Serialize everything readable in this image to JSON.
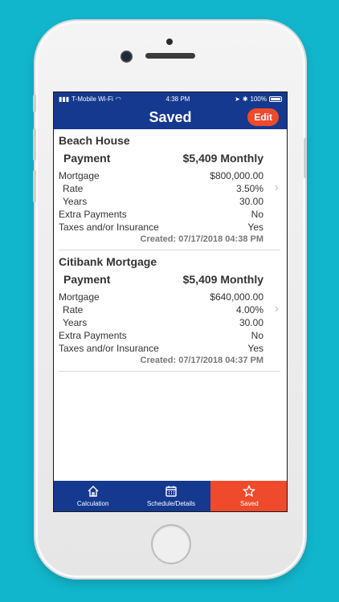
{
  "status_bar": {
    "carrier": "T-Mobile Wi-Fi",
    "time": "4:38 PM",
    "battery": "100%"
  },
  "nav": {
    "title": "Saved",
    "edit_label": "Edit"
  },
  "items": [
    {
      "title": "Beach House",
      "payment_label": "Payment",
      "payment_value": "$5,409 Monthly",
      "mortgage_label": "Mortgage",
      "mortgage_value": "$800,000.00",
      "rate_label": "Rate",
      "rate_value": "3.50%",
      "years_label": "Years",
      "years_value": "30.00",
      "extra_label": "Extra Payments",
      "extra_value": "No",
      "taxes_label": "Taxes and/or Insurance",
      "taxes_value": "Yes",
      "created": "Created: 07/17/2018 04:38 PM"
    },
    {
      "title": "Citibank Mortgage",
      "payment_label": "Payment",
      "payment_value": "$5,409 Monthly",
      "mortgage_label": "Mortgage",
      "mortgage_value": "$640,000.00",
      "rate_label": "Rate",
      "rate_value": "4.00%",
      "years_label": "Years",
      "years_value": "30.00",
      "extra_label": "Extra Payments",
      "extra_value": "No",
      "taxes_label": "Taxes and/or Insurance",
      "taxes_value": "Yes",
      "created": "Created: 07/17/2018 04:37 PM"
    }
  ],
  "tabs": [
    {
      "label": "Calculation",
      "icon": "house-icon"
    },
    {
      "label": "Schedule/Details",
      "icon": "calendar-icon"
    },
    {
      "label": "Saved",
      "icon": "star-icon"
    }
  ],
  "colors": {
    "background": "#12b6cc",
    "nav_blue": "#14398f",
    "accent_red": "#ef4a2c"
  }
}
